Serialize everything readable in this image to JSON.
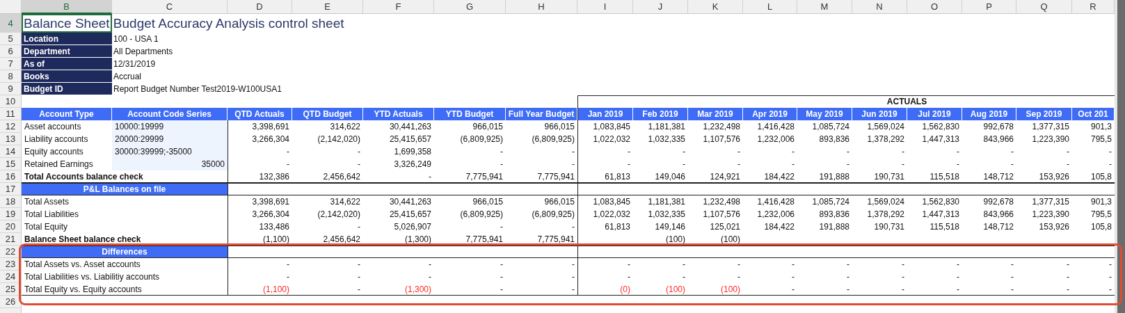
{
  "column_letters": [
    {
      "label": "B",
      "selected": true
    },
    {
      "label": "C",
      "selected": false
    },
    {
      "label": "D",
      "selected": false
    },
    {
      "label": "E",
      "selected": false
    },
    {
      "label": "F",
      "selected": false
    },
    {
      "label": "G",
      "selected": false
    },
    {
      "label": "H",
      "selected": false
    },
    {
      "label": "I",
      "selected": false
    },
    {
      "label": "J",
      "selected": false
    },
    {
      "label": "K",
      "selected": false
    },
    {
      "label": "L",
      "selected": false
    },
    {
      "label": "M",
      "selected": false
    },
    {
      "label": "N",
      "selected": false
    },
    {
      "label": "O",
      "selected": false
    },
    {
      "label": "P",
      "selected": false
    },
    {
      "label": "Q",
      "selected": false
    },
    {
      "label": "R",
      "selected": false
    }
  ],
  "row_numbers": [
    {
      "label": "4",
      "selected": true
    },
    {
      "label": "5",
      "selected": false
    },
    {
      "label": "6",
      "selected": false
    },
    {
      "label": "7",
      "selected": false
    },
    {
      "label": "8",
      "selected": false
    },
    {
      "label": "9",
      "selected": false
    },
    {
      "label": "10",
      "selected": false
    },
    {
      "label": "11",
      "selected": false
    },
    {
      "label": "12",
      "selected": false
    },
    {
      "label": "13",
      "selected": false
    },
    {
      "label": "14",
      "selected": false
    },
    {
      "label": "15",
      "selected": false
    },
    {
      "label": "16",
      "selected": false
    },
    {
      "label": "17",
      "selected": false
    },
    {
      "label": "18",
      "selected": false
    },
    {
      "label": "19",
      "selected": false
    },
    {
      "label": "20",
      "selected": false
    },
    {
      "label": "21",
      "selected": false
    },
    {
      "label": "22",
      "selected": false
    },
    {
      "label": "23",
      "selected": false
    },
    {
      "label": "24",
      "selected": false
    },
    {
      "label": "25",
      "selected": false
    },
    {
      "label": "26",
      "selected": false
    }
  ],
  "title": "Balance Sheet Budget Accuracy Analysis control sheet",
  "info": [
    {
      "label": "Location",
      "value": "100 - USA 1"
    },
    {
      "label": "Department",
      "value": "All Departments"
    },
    {
      "label": "As of",
      "value": "12/31/2019"
    },
    {
      "label": "Books",
      "value": "Accrual"
    },
    {
      "label": "Budget ID",
      "value": "Report Budget Number Test2019-W100USA1"
    }
  ],
  "group_header": "ACTUALS",
  "table": {
    "columns": [
      "Account Type",
      "Account Code Series",
      "QTD Actuals",
      "QTD Budget",
      "YTD Actuals",
      "YTD Budget",
      "Full Year Budget",
      "Jan 2019",
      "Feb 2019",
      "Mar 2019",
      "Apr 2019",
      "May 2019",
      "Jun 2019",
      "Jul 2019",
      "Aug 2019",
      "Sep 2019",
      "Oct 201"
    ],
    "rows": [
      {
        "kind": "account",
        "label": "Asset accounts",
        "code": "10000:19999",
        "values": [
          "3,398,691",
          "314,622",
          "30,441,263",
          "966,015",
          "966,015",
          "1,083,845",
          "1,181,381",
          "1,232,498",
          "1,416,428",
          "1,085,724",
          "1,569,024",
          "1,562,830",
          "992,678",
          "1,377,315",
          "901,3"
        ]
      },
      {
        "kind": "account",
        "label": "Liability accounts",
        "code": "20000:29999",
        "values": [
          "3,266,304",
          "(2,142,020)",
          "25,415,657",
          "(6,809,925)",
          "(6,809,925)",
          "1,022,032",
          "1,032,335",
          "1,107,576",
          "1,232,006",
          "893,836",
          "1,378,292",
          "1,447,313",
          "843,966",
          "1,223,390",
          "795,5"
        ]
      },
      {
        "kind": "account",
        "label": "Equity accounts",
        "code": "30000:39999;-35000",
        "values": [
          "-",
          "-",
          "1,699,358",
          "-",
          "-",
          "-",
          "-",
          "-",
          "-",
          "-",
          "-",
          "-",
          "-",
          "-",
          "-"
        ]
      },
      {
        "kind": "account",
        "label": "Retained Earnings",
        "code": "35000",
        "values": [
          "-",
          "-",
          "3,326,249",
          "-",
          "-",
          "-",
          "-",
          "-",
          "-",
          "-",
          "-",
          "-",
          "-",
          "-",
          "-"
        ]
      },
      {
        "kind": "total",
        "label": "Total Accounts balance check",
        "values": [
          "132,386",
          "2,456,642",
          "-",
          "7,775,941",
          "7,775,941",
          "61,813",
          "149,046",
          "124,921",
          "184,422",
          "191,888",
          "190,731",
          "115,518",
          "148,712",
          "153,926",
          "105,8"
        ]
      },
      {
        "kind": "section",
        "label": "P&L Balances on file"
      },
      {
        "kind": "line",
        "label": "Total Assets",
        "values": [
          "3,398,691",
          "314,622",
          "30,441,263",
          "966,015",
          "966,015",
          "1,083,845",
          "1,181,381",
          "1,232,498",
          "1,416,428",
          "1,085,724",
          "1,569,024",
          "1,562,830",
          "992,678",
          "1,377,315",
          "901,3"
        ]
      },
      {
        "kind": "line",
        "label": "Total Liabilities",
        "values": [
          "3,266,304",
          "(2,142,020)",
          "25,415,657",
          "(6,809,925)",
          "(6,809,925)",
          "1,022,032",
          "1,032,335",
          "1,107,576",
          "1,232,006",
          "893,836",
          "1,378,292",
          "1,447,313",
          "843,966",
          "1,223,390",
          "795,5"
        ]
      },
      {
        "kind": "line",
        "label": "Total Equity",
        "values": [
          "133,486",
          "-",
          "5,026,907",
          "-",
          "-",
          "61,813",
          "149,146",
          "125,021",
          "184,422",
          "191,888",
          "190,731",
          "115,518",
          "148,712",
          "153,926",
          "105,8"
        ]
      },
      {
        "kind": "total",
        "label": "Balance Sheet balance check",
        "first_month_blank": true,
        "values": [
          "(1,100)",
          "2,456,642",
          "(1,300)",
          "7,775,941",
          "7,775,941",
          "(100)",
          "(100)"
        ]
      },
      {
        "kind": "section",
        "label": "Differences"
      },
      {
        "kind": "line",
        "label": "Total Assets vs. Asset accounts",
        "values": [
          "-",
          "-",
          "-",
          "-",
          "-",
          "-",
          "-",
          "-",
          "-",
          "-",
          "-",
          "-",
          "-",
          "-",
          "-"
        ]
      },
      {
        "kind": "line",
        "label": "Total Liabilities vs. Liabilitiy accounts",
        "values": [
          "-",
          "-",
          "-",
          "-",
          "-",
          "-",
          "-",
          "-",
          "-",
          "-",
          "-",
          "-",
          "-",
          "-",
          "-"
        ]
      },
      {
        "kind": "line",
        "label": "Total Equity vs. Equity accounts",
        "values": [
          "(1,100)",
          "-",
          "(1,300)",
          "-",
          "-",
          "(0)",
          "(100)",
          "(100)",
          "-",
          "-",
          "-",
          "-",
          "-",
          "-",
          "-"
        ],
        "alerts": [
          true,
          false,
          true,
          false,
          false,
          true,
          true,
          true,
          false,
          false,
          false,
          false,
          false,
          false,
          false
        ]
      },
      {
        "kind": "blank"
      }
    ]
  }
}
